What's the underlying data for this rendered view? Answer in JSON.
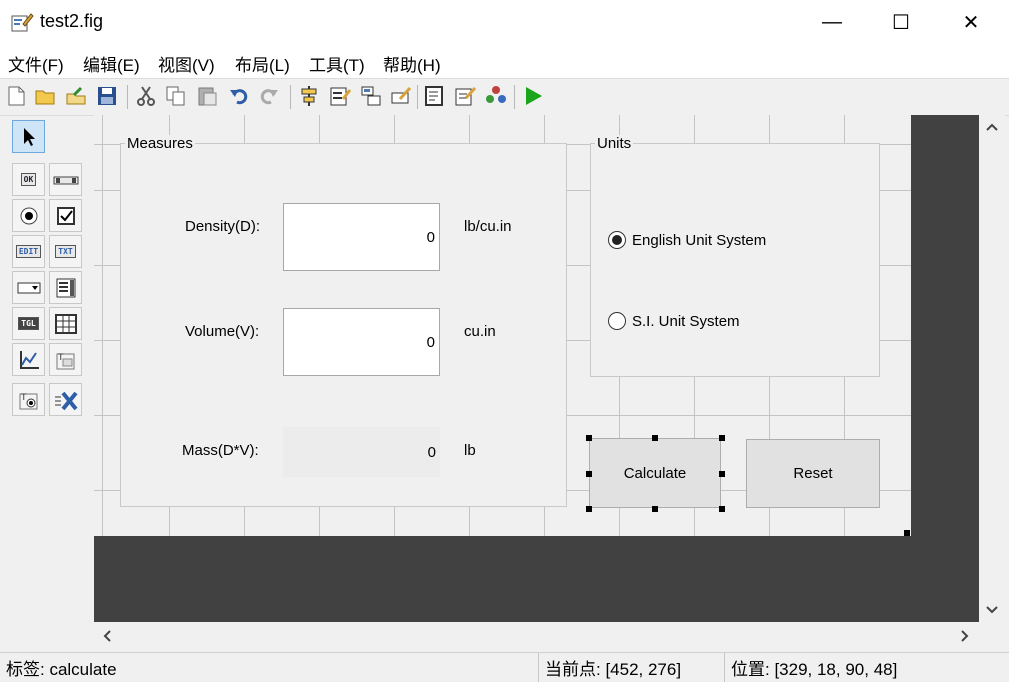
{
  "window": {
    "title": "test2.fig",
    "minimize": "—",
    "maximize": "☐",
    "close": "✕"
  },
  "menubar": [
    "文件(F)",
    "编辑(E)",
    "视图(V)",
    "布局(L)",
    "工具(T)",
    "帮助(H)"
  ],
  "palette": {
    "ok": "OK",
    "edit": "EDIT",
    "txt": "TXT",
    "tgl": "TGL"
  },
  "figure": {
    "measures": {
      "title": "Measures",
      "density_label": "Density(D):",
      "density_value": "0",
      "density_unit": "lb/cu.in",
      "volume_label": "Volume(V):",
      "volume_value": "0",
      "volume_unit": "cu.in",
      "mass_label": "Mass(D*V):",
      "mass_value": "0",
      "mass_unit": "lb"
    },
    "units": {
      "title": "Units",
      "english": "English Unit System",
      "english_selected": true,
      "si": "S.I. Unit System",
      "si_selected": false
    },
    "calculate": "Calculate",
    "reset": "Reset"
  },
  "statusbar": {
    "tag": "标签: calculate",
    "current_point": "当前点:  [452, 276]",
    "position": "位置: [329, 18, 90, 48]"
  },
  "colors": {
    "canvas_dark": "#414141",
    "run_green": "#1aa51a",
    "selected_tool": "#cde5f7"
  }
}
